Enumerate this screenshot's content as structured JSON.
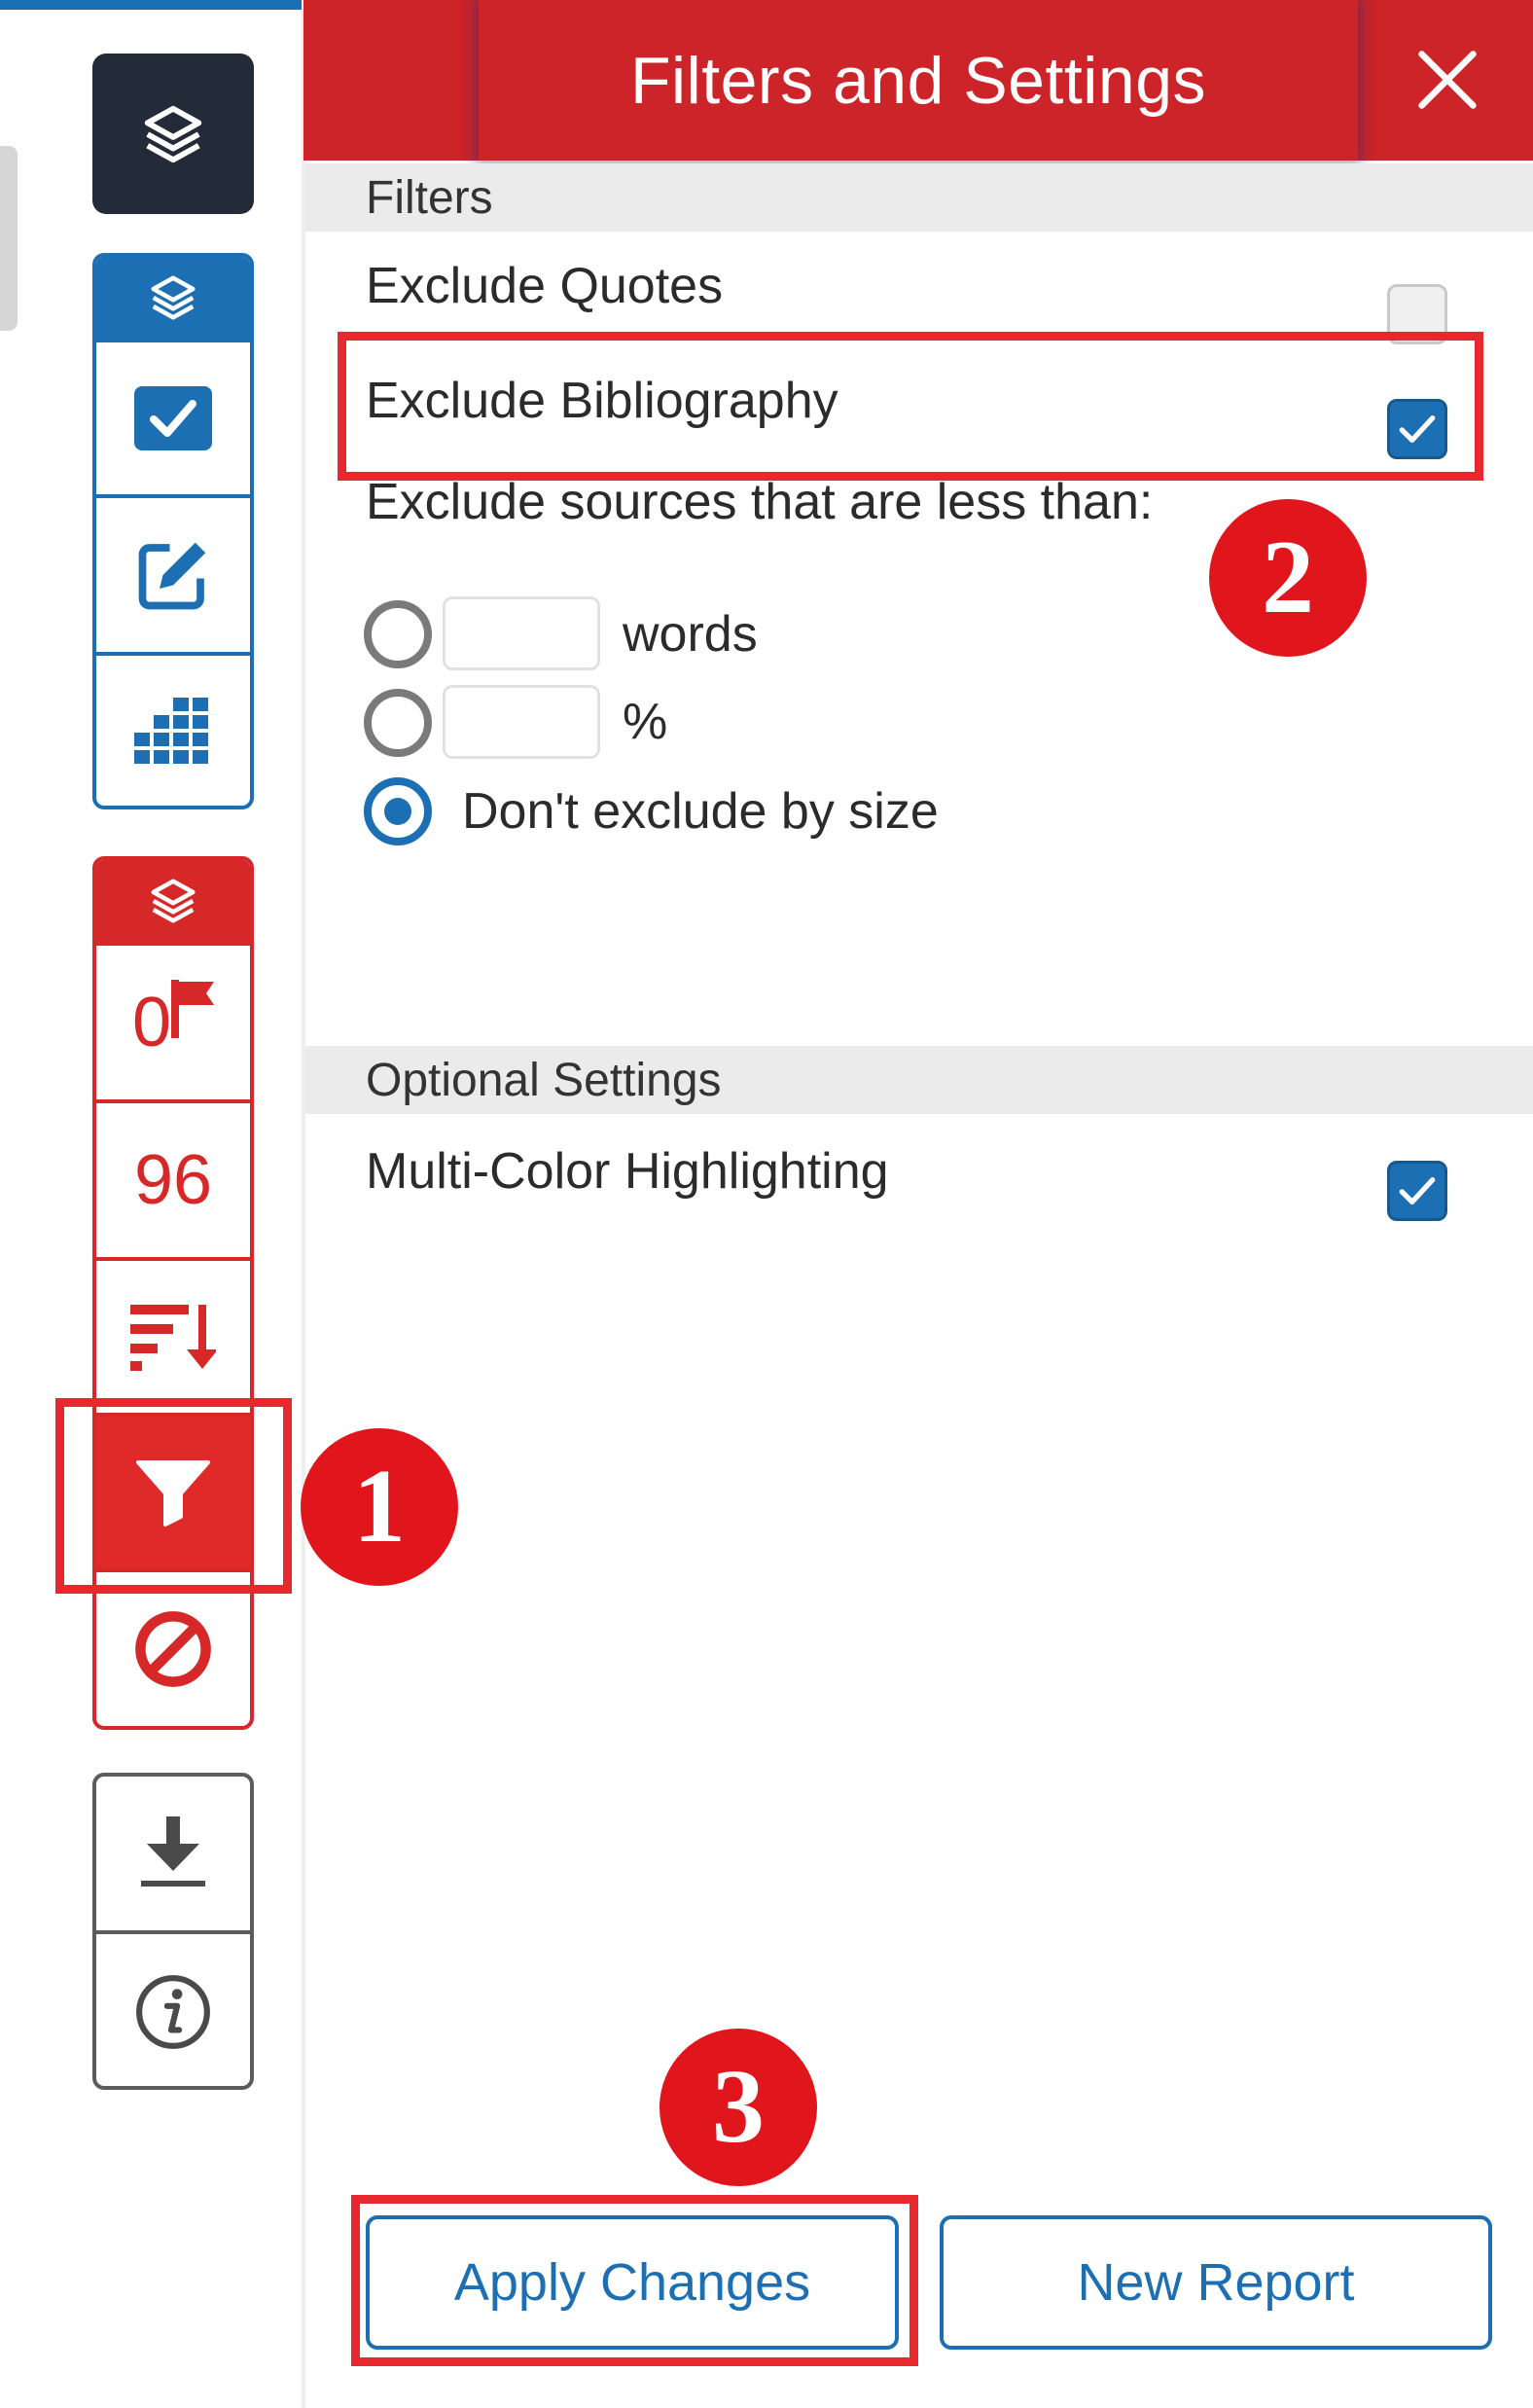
{
  "header": {
    "title": "Filters and Settings"
  },
  "sidebar": {
    "match_count": "96",
    "flag_count": "0"
  },
  "filters": {
    "section_label": "Filters",
    "exclude_quotes": {
      "label": "Exclude Quotes",
      "checked": false
    },
    "exclude_bibliography": {
      "label": "Exclude Bibliography",
      "checked": true
    },
    "size_label": "Exclude sources that are less than:",
    "words_option": {
      "unit": "words",
      "value": ""
    },
    "percent_option": {
      "unit": "%",
      "value": ""
    },
    "no_size_option": {
      "label": "Don't exclude by size",
      "selected": true
    }
  },
  "optional_settings": {
    "section_label": "Optional Settings",
    "multi_color": {
      "label": "Multi-Color Highlighting",
      "checked": true
    }
  },
  "buttons": {
    "apply": "Apply Changes",
    "new_report": "New Report"
  },
  "annotations": {
    "step_1": "1",
    "step_2": "2",
    "step_3": "3"
  },
  "colors": {
    "header_red": "#cc2428",
    "accent_blue": "#1d6fb4",
    "alert_red": "#d62828",
    "dark_tile": "#232a38",
    "callout_red": "#e0161c"
  }
}
